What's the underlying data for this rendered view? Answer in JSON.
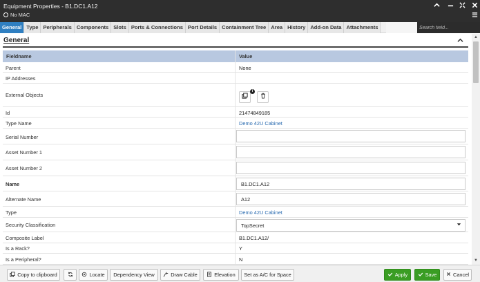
{
  "window": {
    "title": "Equipment Properties - B1.DC1.A12",
    "subtitle": "No MAC",
    "controls": {
      "collapse": "▲",
      "minimize": "—",
      "expand": "✕",
      "close": "✖",
      "menu": "≡"
    }
  },
  "tabs": [
    {
      "label": "General",
      "active": true
    },
    {
      "label": "Type"
    },
    {
      "label": "Peripherals"
    },
    {
      "label": "Components"
    },
    {
      "label": "Slots"
    },
    {
      "label": "Ports & Connections"
    },
    {
      "label": "Port Details"
    },
    {
      "label": "Containment Tree"
    },
    {
      "label": "Area"
    },
    {
      "label": "History"
    },
    {
      "label": "Add-on Data"
    },
    {
      "label": "Attachments"
    }
  ],
  "search": {
    "placeholder": "Search field..."
  },
  "section": {
    "title": "General",
    "collapse_icon": "⌃"
  },
  "table": {
    "col_fieldname": "Fieldname",
    "col_value": "Value",
    "rows": {
      "parent": {
        "label": "Parent",
        "value": "None"
      },
      "ip": {
        "label": "IP Addresses",
        "value": ""
      },
      "external": {
        "label": "External Objects"
      },
      "id": {
        "label": "Id",
        "value": "21474849185"
      },
      "type_name": {
        "label": "Type Name",
        "value": "Demo 42U Cabinet"
      },
      "serial": {
        "label": "Serial Number",
        "value": ""
      },
      "asset1": {
        "label": "Asset Number 1",
        "value": ""
      },
      "asset2": {
        "label": "Asset Number 2",
        "value": ""
      },
      "name": {
        "label": "Name",
        "value": "B1.DC1.A12"
      },
      "alt_name": {
        "label": "Alternate Name",
        "value": "A12"
      },
      "type": {
        "label": "Type",
        "value": "Demo 42U Cabinet"
      },
      "security": {
        "label": "Security Classification",
        "value": "TopSecret"
      },
      "composite": {
        "label": "Composite Label",
        "value": "B1.DC1.A12/"
      },
      "is_rack": {
        "label": "Is a Rack?",
        "value": "Y"
      },
      "is_peripheral": {
        "label": "Is a Peripheral?",
        "value": "N"
      }
    }
  },
  "footer": {
    "copy": "Copy to clipboard",
    "locate": "Locate",
    "dependency": "Dependency View",
    "draw_cable": "Draw Cable",
    "elevation": "Elevation",
    "set_ac": "Set as A/C for Space",
    "apply": "Apply",
    "save": "Save",
    "cancel": "Cancel"
  }
}
